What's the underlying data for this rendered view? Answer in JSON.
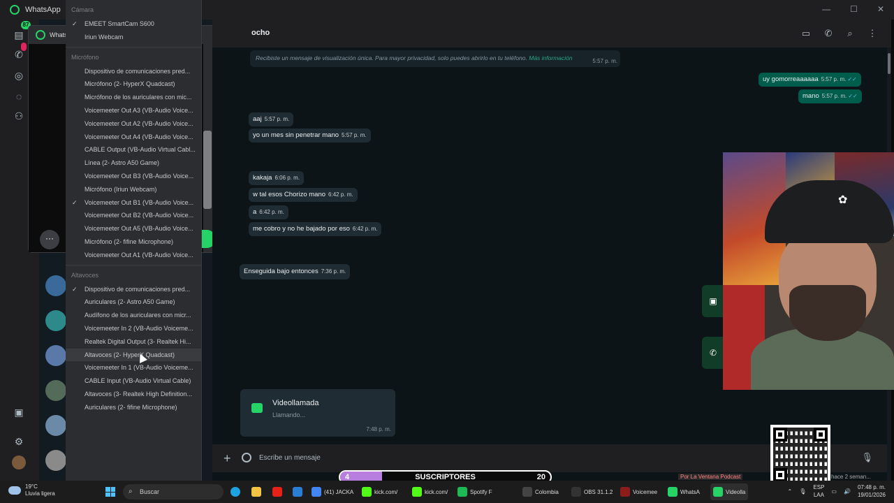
{
  "window": {
    "title": "WhatsApp"
  },
  "rail": {
    "badge_chats": "87"
  },
  "call_window": {
    "title": "WhatsApp",
    "more_label": "···"
  },
  "device_menu": {
    "camera_header": "Cámara",
    "cameras": [
      {
        "label": "EMEET SmartCam S600",
        "checked": true
      },
      {
        "label": "Iriun Webcam",
        "checked": false
      }
    ],
    "mic_header": "Micrófono",
    "mics": [
      {
        "label": "Dispositivo de comunicaciones pred...",
        "checked": false
      },
      {
        "label": "Micrófono (2- HyperX Quadcast)",
        "checked": false
      },
      {
        "label": "Micrófono de los auriculares con mic...",
        "checked": false
      },
      {
        "label": "Voicemeeter Out A3 (VB-Audio Voice...",
        "checked": false
      },
      {
        "label": "Voicemeeter Out A2 (VB-Audio Voice...",
        "checked": false
      },
      {
        "label": "Voicemeeter Out A4 (VB-Audio Voice...",
        "checked": false
      },
      {
        "label": "CABLE Output (VB-Audio Virtual Cabl...",
        "checked": false
      },
      {
        "label": "Línea (2- Astro A50 Game)",
        "checked": false
      },
      {
        "label": "Voicemeeter Out B3 (VB-Audio Voice...",
        "checked": false
      },
      {
        "label": "Micrófono (Iriun Webcam)",
        "checked": false
      },
      {
        "label": "Voicemeeter Out B1 (VB-Audio Voice...",
        "checked": true
      },
      {
        "label": "Voicemeeter Out B2 (VB-Audio Voice...",
        "checked": false
      },
      {
        "label": "Voicemeeter Out A5 (VB-Audio Voice...",
        "checked": false
      },
      {
        "label": "Micrófono (2- fifine Microphone)",
        "checked": false
      },
      {
        "label": "Voicemeeter Out A1 (VB-Audio Voice...",
        "checked": false
      }
    ],
    "speaker_header": "Altavoces",
    "speakers": [
      {
        "label": "Dispositivo de comunicaciones pred...",
        "checked": true
      },
      {
        "label": "Auriculares (2- Astro A50 Game)",
        "checked": false
      },
      {
        "label": "Audífono de los auriculares con micr...",
        "checked": false
      },
      {
        "label": "Voicemeeter In 2 (VB-Audio Voiceme...",
        "checked": false
      },
      {
        "label": "Realtek Digital Output (3- Realtek Hi...",
        "checked": false
      },
      {
        "label": "Altavoces (2- HyperX Quadcast)",
        "checked": false,
        "hover": true
      },
      {
        "label": "Voicemeeter In 1 (VB-Audio Voiceme...",
        "checked": false
      },
      {
        "label": "CABLE Input (VB-Audio Virtual Cable)",
        "checked": false
      },
      {
        "label": "Altavoces (3- Realtek High Definition...",
        "checked": false
      },
      {
        "label": "Auriculares (2- fifine Microphone)",
        "checked": false
      }
    ]
  },
  "chat": {
    "contact_name": "ocho",
    "system_message": {
      "text": "Recibiste un mensaje de visualización única. Para mayor privacidad, solo puedes abrirlo en tu teléfono.",
      "link": "Más información",
      "time": "5:57 p. m."
    },
    "messages": [
      {
        "text": "uy gomorreaaaaaa",
        "time": "5:57 p. m.",
        "out": true,
        "ticks": "✓✓"
      },
      {
        "text": "mano",
        "time": "5:57 p. m.",
        "out": true,
        "ticks": "✓✓"
      },
      {
        "text": "aaj",
        "time": "5:57 p. m.",
        "out": false
      },
      {
        "text": "yo un mes sin penetrar mano",
        "time": "5:57 p. m.",
        "out": false
      },
      {
        "text": "kakaja",
        "time": "6:06 p. m.",
        "out": false
      },
      {
        "text": "w tal esos Chorizo mano",
        "time": "6:42 p. m.",
        "out": false
      },
      {
        "text": "a",
        "time": "6:42 p. m.",
        "out": false
      },
      {
        "text": "me cobro y no he bajado por eso",
        "time": "6:42 p. m.",
        "out": false
      },
      {
        "text": "Enseguida  bajo entonces",
        "time": "7:36 p. m.",
        "out": false
      }
    ],
    "call_card": {
      "title": "Videollamada",
      "subtitle": "Llamando...",
      "time": "7:48 p. m."
    },
    "composer_placeholder": "Escribe un mensaje"
  },
  "overlay": {
    "subs_current": "4",
    "subs_label": "SUSCRIPTORES",
    "subs_goal": "20",
    "subs_progress_fraction": 0.2,
    "ticker_left": "Por La Ventana Podcast",
    "ticker_right": "hace 2 seman..."
  },
  "taskbar": {
    "weather_temp": "19°C",
    "weather_desc": "Lluvia ligera",
    "search_label": "Buscar",
    "apps": [
      {
        "label": "(41) JACKA",
        "color": "#4285f4"
      },
      {
        "label": "kick.com/",
        "color": "#53fc18"
      },
      {
        "label": "kick.com/",
        "color": "#53fc18"
      },
      {
        "label": "Spotify F",
        "color": "#1db954"
      },
      {
        "label": "Colombia",
        "color": "#444"
      },
      {
        "label": "OBS 31.1.2",
        "color": "#333"
      },
      {
        "label": "Voicemee",
        "color": "#8a1c1c"
      },
      {
        "label": "WhatsA",
        "color": "#25d366"
      },
      {
        "label": "Videolla",
        "color": "#25d366"
      }
    ],
    "lang": "ESP",
    "layout": "LAA",
    "time": "07:48 p. m.",
    "date": "19/01/2026"
  }
}
